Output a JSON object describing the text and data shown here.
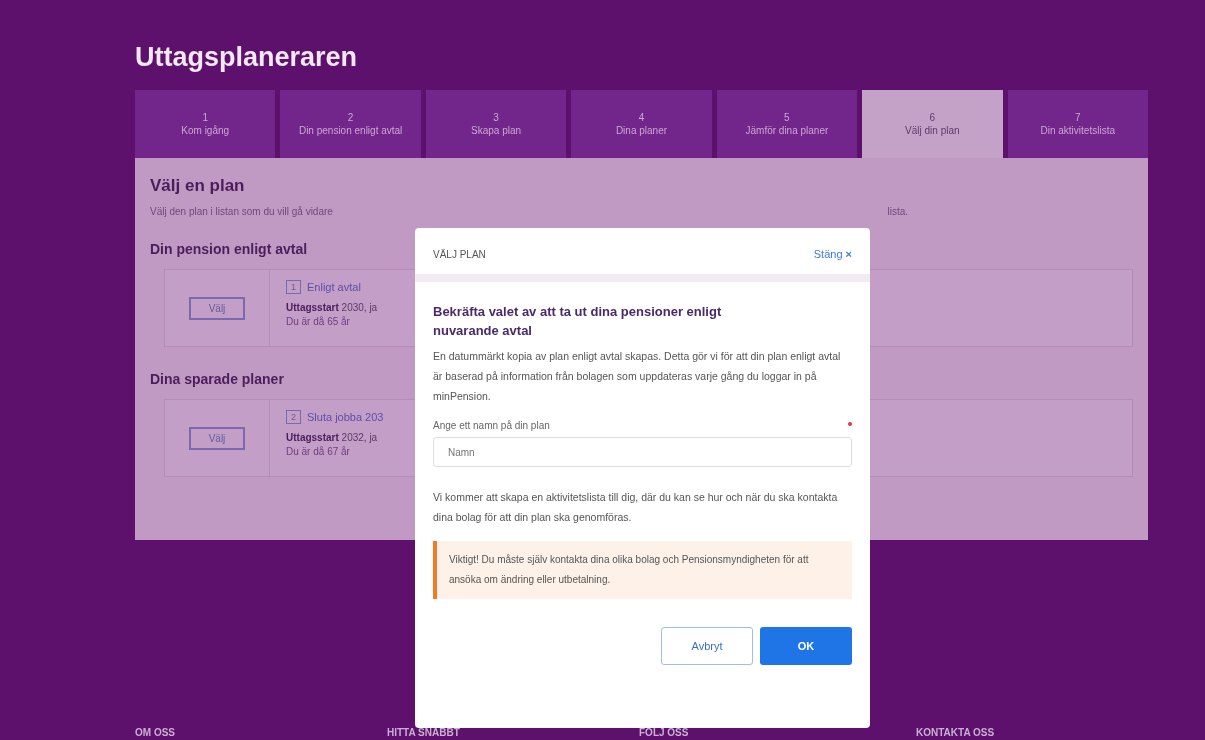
{
  "page_title": "Uttagsplaneraren",
  "tabs": [
    {
      "number": "1",
      "label": "Kom igång",
      "selected": false
    },
    {
      "number": "2",
      "label": "Din pension enligt avtal",
      "selected": false
    },
    {
      "number": "3",
      "label": "Skapa plan",
      "selected": false
    },
    {
      "number": "4",
      "label": "Dina planer",
      "selected": false
    },
    {
      "number": "5",
      "label": "Jämför dina planer",
      "selected": false
    },
    {
      "number": "6",
      "label": "Välj din plan",
      "selected": true
    },
    {
      "number": "7",
      "label": "Din aktivitetslista",
      "selected": false
    }
  ],
  "panel": {
    "heading": "Välj en plan",
    "intro_start": "Välj den plan i listan som du vill gå vidare",
    "intro_end": "lista.",
    "sections": [
      {
        "heading": "Din pension enligt avtal",
        "plans": [
          {
            "button": "Välj",
            "number": "1",
            "name": "Enligt avtal",
            "start_label": "Uttagsstart",
            "start_value": "2030, ja",
            "age": "Du är då 65 år"
          }
        ]
      },
      {
        "heading": "Dina sparade planer",
        "plans": [
          {
            "button": "Välj",
            "number": "2",
            "name": "Sluta jobba 203",
            "start_label": "Uttagsstart",
            "start_value": "2032, ja",
            "age": "Du är då 67 år"
          }
        ]
      }
    ]
  },
  "footer": [
    "OM OSS",
    "HITTA SNABBT",
    "FÖLJ OSS",
    "KONTAKTA OSS"
  ],
  "dialog": {
    "title": "VÄLJ PLAN",
    "close": "Stäng",
    "close_glyph": "×",
    "heading": "Bekräfta valet av att ta ut dina pensioner enligt nuvarande avtal",
    "text": "En datummärkt kopia av plan enligt avtal skapas. Detta gör vi för att din plan enligt avtal är baserad på information från bolagen som uppdateras varje gång du loggar in på minPension.",
    "field": {
      "label": "Ange ett namn på din plan",
      "placeholder": "Namn",
      "required": true
    },
    "note": "Vi kommer att skapa en aktivitetslista till dig, där du kan se hur och när du ska kontakta dina bolag för att din plan ska genomföras.",
    "warning": "Viktigt! Du måste själv kontakta dina olika bolag och Pensionsmyndigheten för att ansöka om ändring eller utbetalning.",
    "buttons": [
      {
        "label": "Avbryt",
        "kind": "secondary"
      },
      {
        "label": "OK",
        "kind": "primary"
      }
    ]
  }
}
